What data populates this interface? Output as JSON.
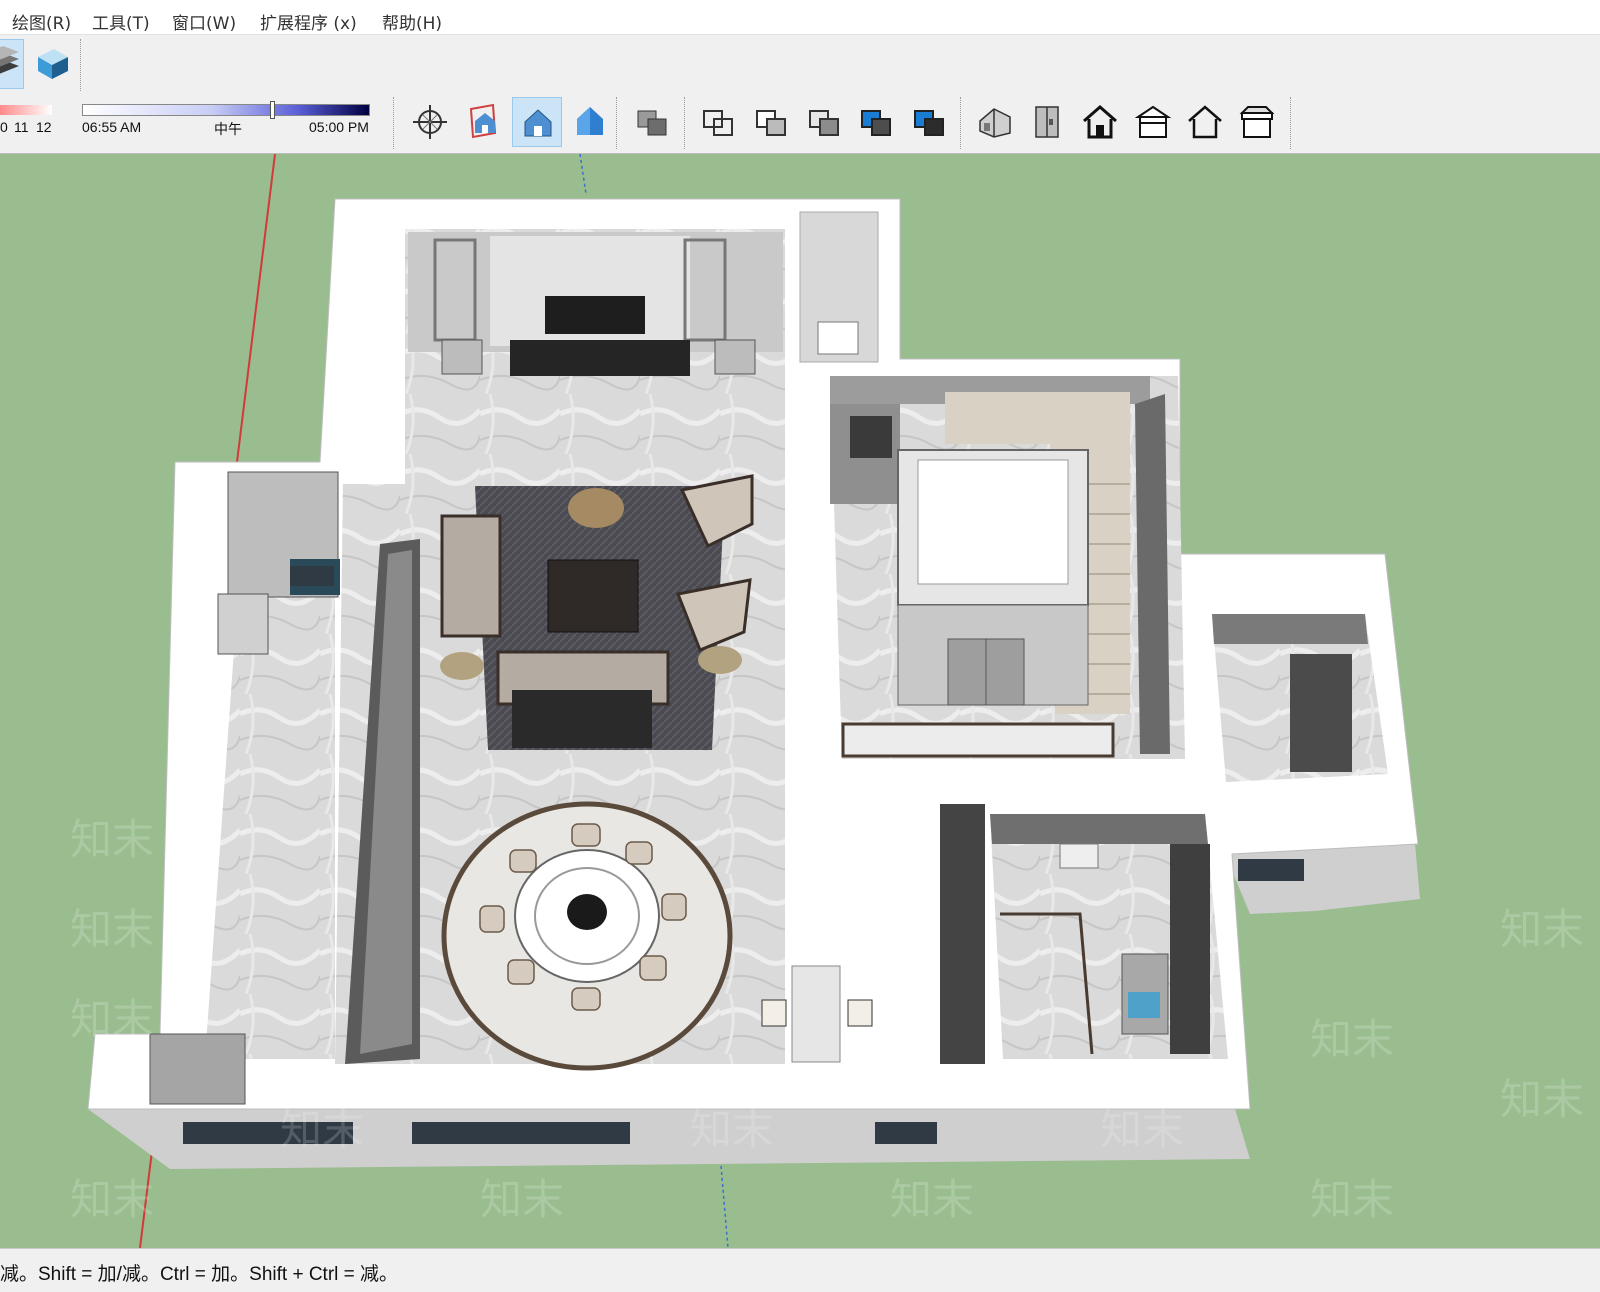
{
  "menu": [
    {
      "id": "draw",
      "label": "绘图(R)"
    },
    {
      "id": "tools",
      "label": "工具(T)"
    },
    {
      "id": "window",
      "label": "窗口(W)"
    },
    {
      "id": "extensions",
      "label": "扩展程序 (x)"
    },
    {
      "id": "help",
      "label": "帮助(H)"
    }
  ],
  "shadow": {
    "month_ticks": [
      "0",
      "11",
      "12"
    ],
    "time_start": "06:55 AM",
    "time_mid": "中午",
    "time_end": "05:00 PM",
    "time_position": 0.66
  },
  "toolbar": {
    "active_view": "iso-view",
    "view_icons": [
      "orbit-icon",
      "iso-view-icon",
      "top-view-icon",
      "front-view-icon"
    ],
    "style_icons": [
      "xray-icon",
      "wireframe-icon",
      "hidden-line-icon",
      "shaded-icon",
      "shaded-texture-icon",
      "monochrome-icon"
    ],
    "camera_icons": [
      "iso-house-icon",
      "right-view-icon",
      "front-house-icon",
      "back-view-icon",
      "left-house-icon",
      "bottom-view-icon"
    ]
  },
  "watermark": "知末",
  "status_text": "减。Shift = 加/减。Ctrl = 加。Shift + Ctrl = 减。",
  "colors": {
    "ground": "#99bd8e",
    "wall": "#ffffff",
    "floor": "#dcdcdc",
    "dark_wall": "#6e6e6e",
    "toolbar_bg": "#f0f0f0",
    "active_button": "#cce4f7"
  }
}
